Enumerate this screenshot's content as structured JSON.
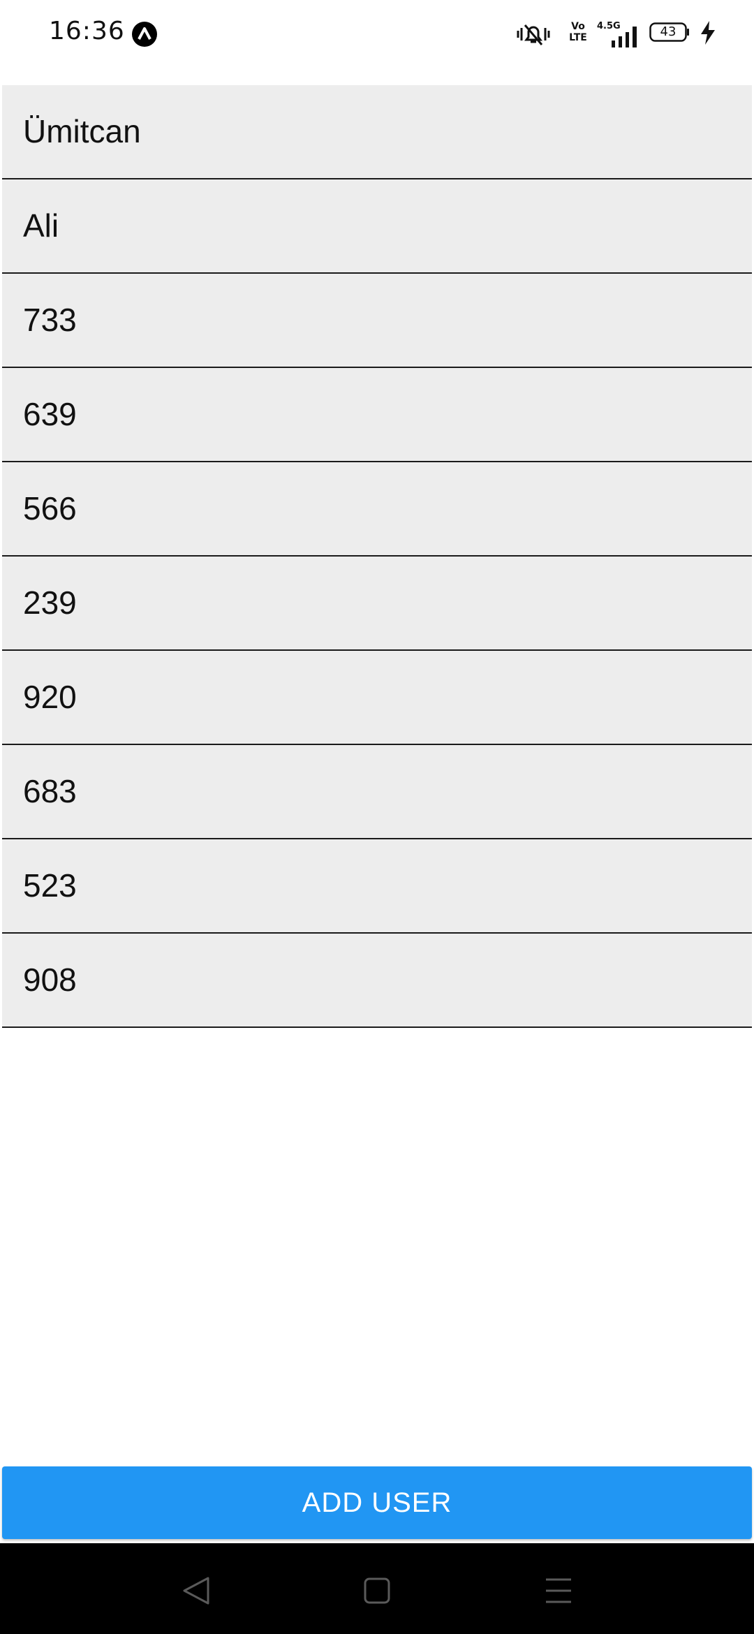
{
  "status_bar": {
    "time": "16:36",
    "network_type": "4.5G",
    "volte_top": "Vo",
    "volte_bottom": "LTE",
    "battery_level": "43"
  },
  "users": [
    {
      "label": "Ümitcan"
    },
    {
      "label": "Ali"
    },
    {
      "label": "733"
    },
    {
      "label": "639"
    },
    {
      "label": "566"
    },
    {
      "label": "239"
    },
    {
      "label": "920"
    },
    {
      "label": "683"
    },
    {
      "label": "523"
    },
    {
      "label": "908"
    }
  ],
  "add_user_button": {
    "label": "ADD USER",
    "color": "#2196f3"
  },
  "nav_bar": {
    "icons": [
      "back-icon",
      "home-icon",
      "menu-icon"
    ]
  }
}
